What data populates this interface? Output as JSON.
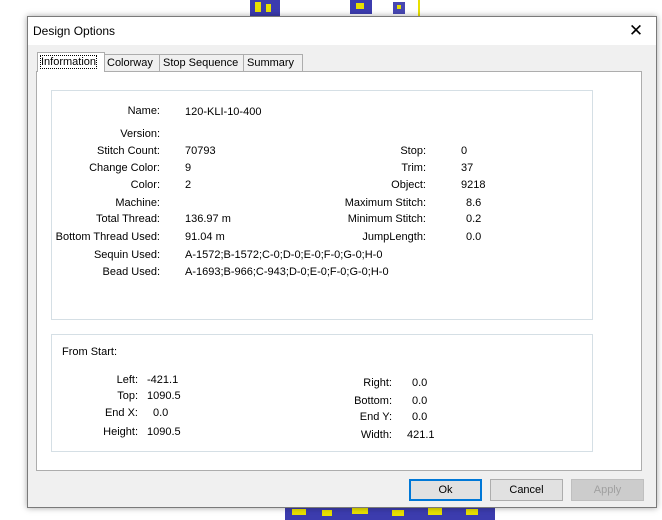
{
  "dialog": {
    "title": "Design Options",
    "close_glyph": "✕"
  },
  "tabs": [
    {
      "label": "Information",
      "active": true
    },
    {
      "label": "Colorway",
      "active": false
    },
    {
      "label": "Stop Sequence",
      "active": false
    },
    {
      "label": "Summary",
      "active": false
    }
  ],
  "info": {
    "name_label": "Name:",
    "name": "120-KLI-10-400",
    "version_label": "Version:",
    "version": "",
    "stitch_count_label": "Stitch Count:",
    "stitch_count": "70793",
    "change_color_label": "Change Color:",
    "change_color": "9",
    "color_label": "Color:",
    "color": "2",
    "machine_label": "Machine:",
    "machine": "",
    "total_thread_label": "Total Thread:",
    "total_thread": "136.97 m",
    "bottom_thread_label": "Bottom Thread Used:",
    "bottom_thread": "91.04 m",
    "sequin_label": "Sequin Used:",
    "sequin": "A-1572;B-1572;C-0;D-0;E-0;F-0;G-0;H-0",
    "bead_label": "Bead Used:",
    "bead": "A-1693;B-966;C-943;D-0;E-0;F-0;G-0;H-0",
    "stop_label": "Stop:",
    "stop": "0",
    "trim_label": "Trim:",
    "trim": "37",
    "object_label": "Object:",
    "object": "9218",
    "max_stitch_label": "Maximum Stitch:",
    "max_stitch": "8.6",
    "min_stitch_label": "Minimum Stitch:",
    "min_stitch": "0.2",
    "jump_length_label": "JumpLength:",
    "jump_length": "0.0"
  },
  "from_start": {
    "heading": "From Start:",
    "left_label": "Left:",
    "left": "-421.1",
    "top_label": "Top:",
    "top": "1090.5",
    "end_x_label": "End X:",
    "end_x": "0.0",
    "height_label": "Height:",
    "height": "1090.5",
    "right_label": "Right:",
    "right": "0.0",
    "bottom_label": "Bottom:",
    "bottom": "0.0",
    "end_y_label": "End Y:",
    "end_y": "0.0",
    "width_label": "Width:",
    "width": "421.1"
  },
  "buttons": {
    "ok": "Ok",
    "cancel": "Cancel",
    "apply": "Apply"
  },
  "colors": {
    "embroidery_blue": "#1a1aa0",
    "embroidery_yellow": "#e8e000",
    "default_button_border": "#0078d7"
  }
}
